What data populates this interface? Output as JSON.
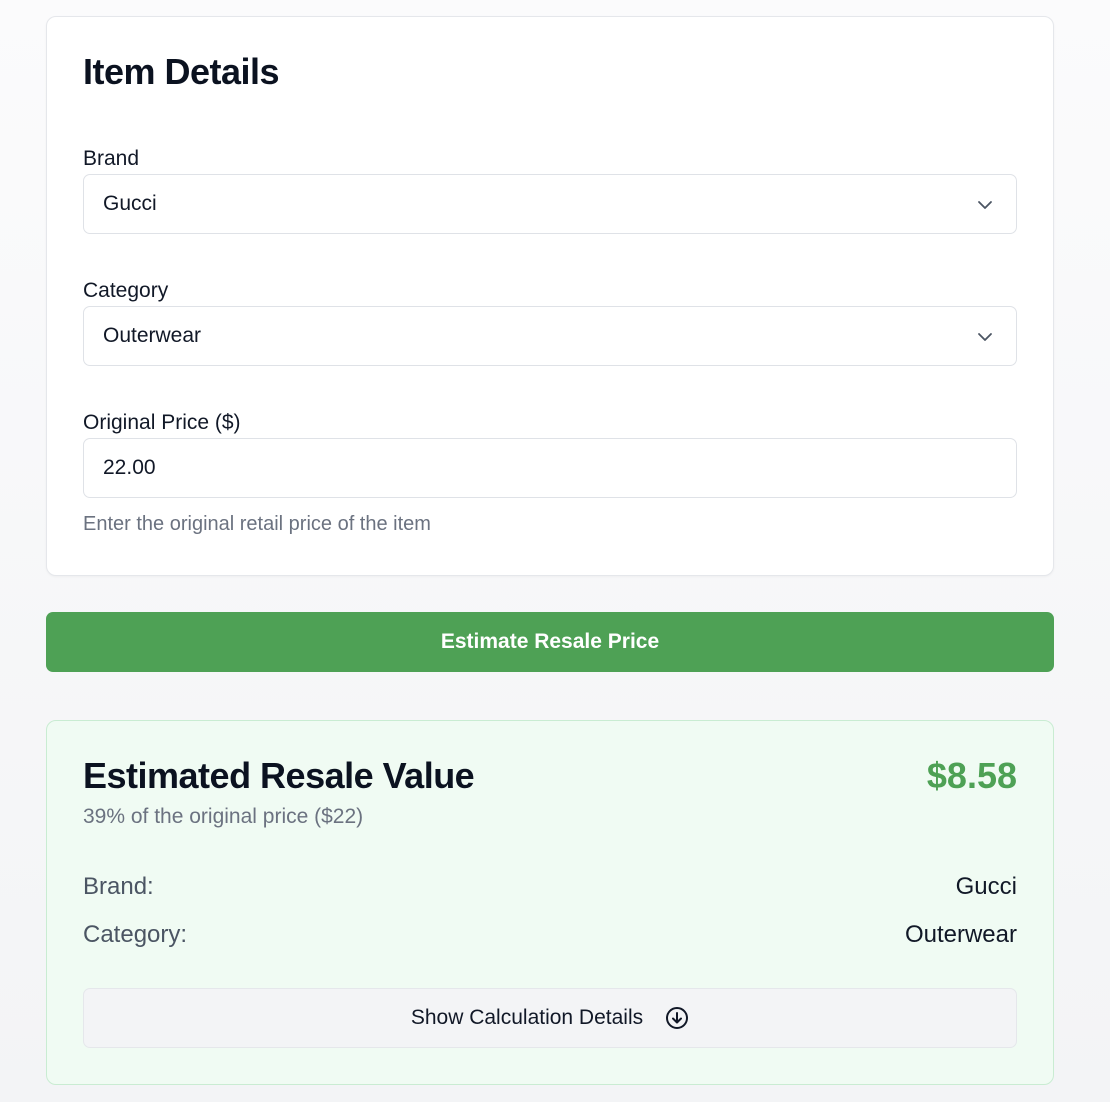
{
  "item_details": {
    "title": "Item Details",
    "brand_label": "Brand",
    "brand_value": "Gucci",
    "category_label": "Category",
    "category_value": "Outerwear",
    "price_label": "Original Price ($)",
    "price_value": "22.00",
    "price_hint": "Enter the original retail price of the item"
  },
  "estimate_button": "Estimate Resale Price",
  "result": {
    "title": "Estimated Resale Value",
    "price": "$8.58",
    "subtitle": "39% of the original price ($22)",
    "brand_label": "Brand:",
    "brand_value": "Gucci",
    "category_label": "Category:",
    "category_value": "Outerwear",
    "details_button": "Show Calculation Details"
  },
  "icons": {
    "select_chevron": "chevron-down-icon",
    "details": "arrow-down-circle-icon"
  },
  "colors": {
    "accent_green": "#4ea155",
    "result_bg": "#f0fbf3"
  }
}
